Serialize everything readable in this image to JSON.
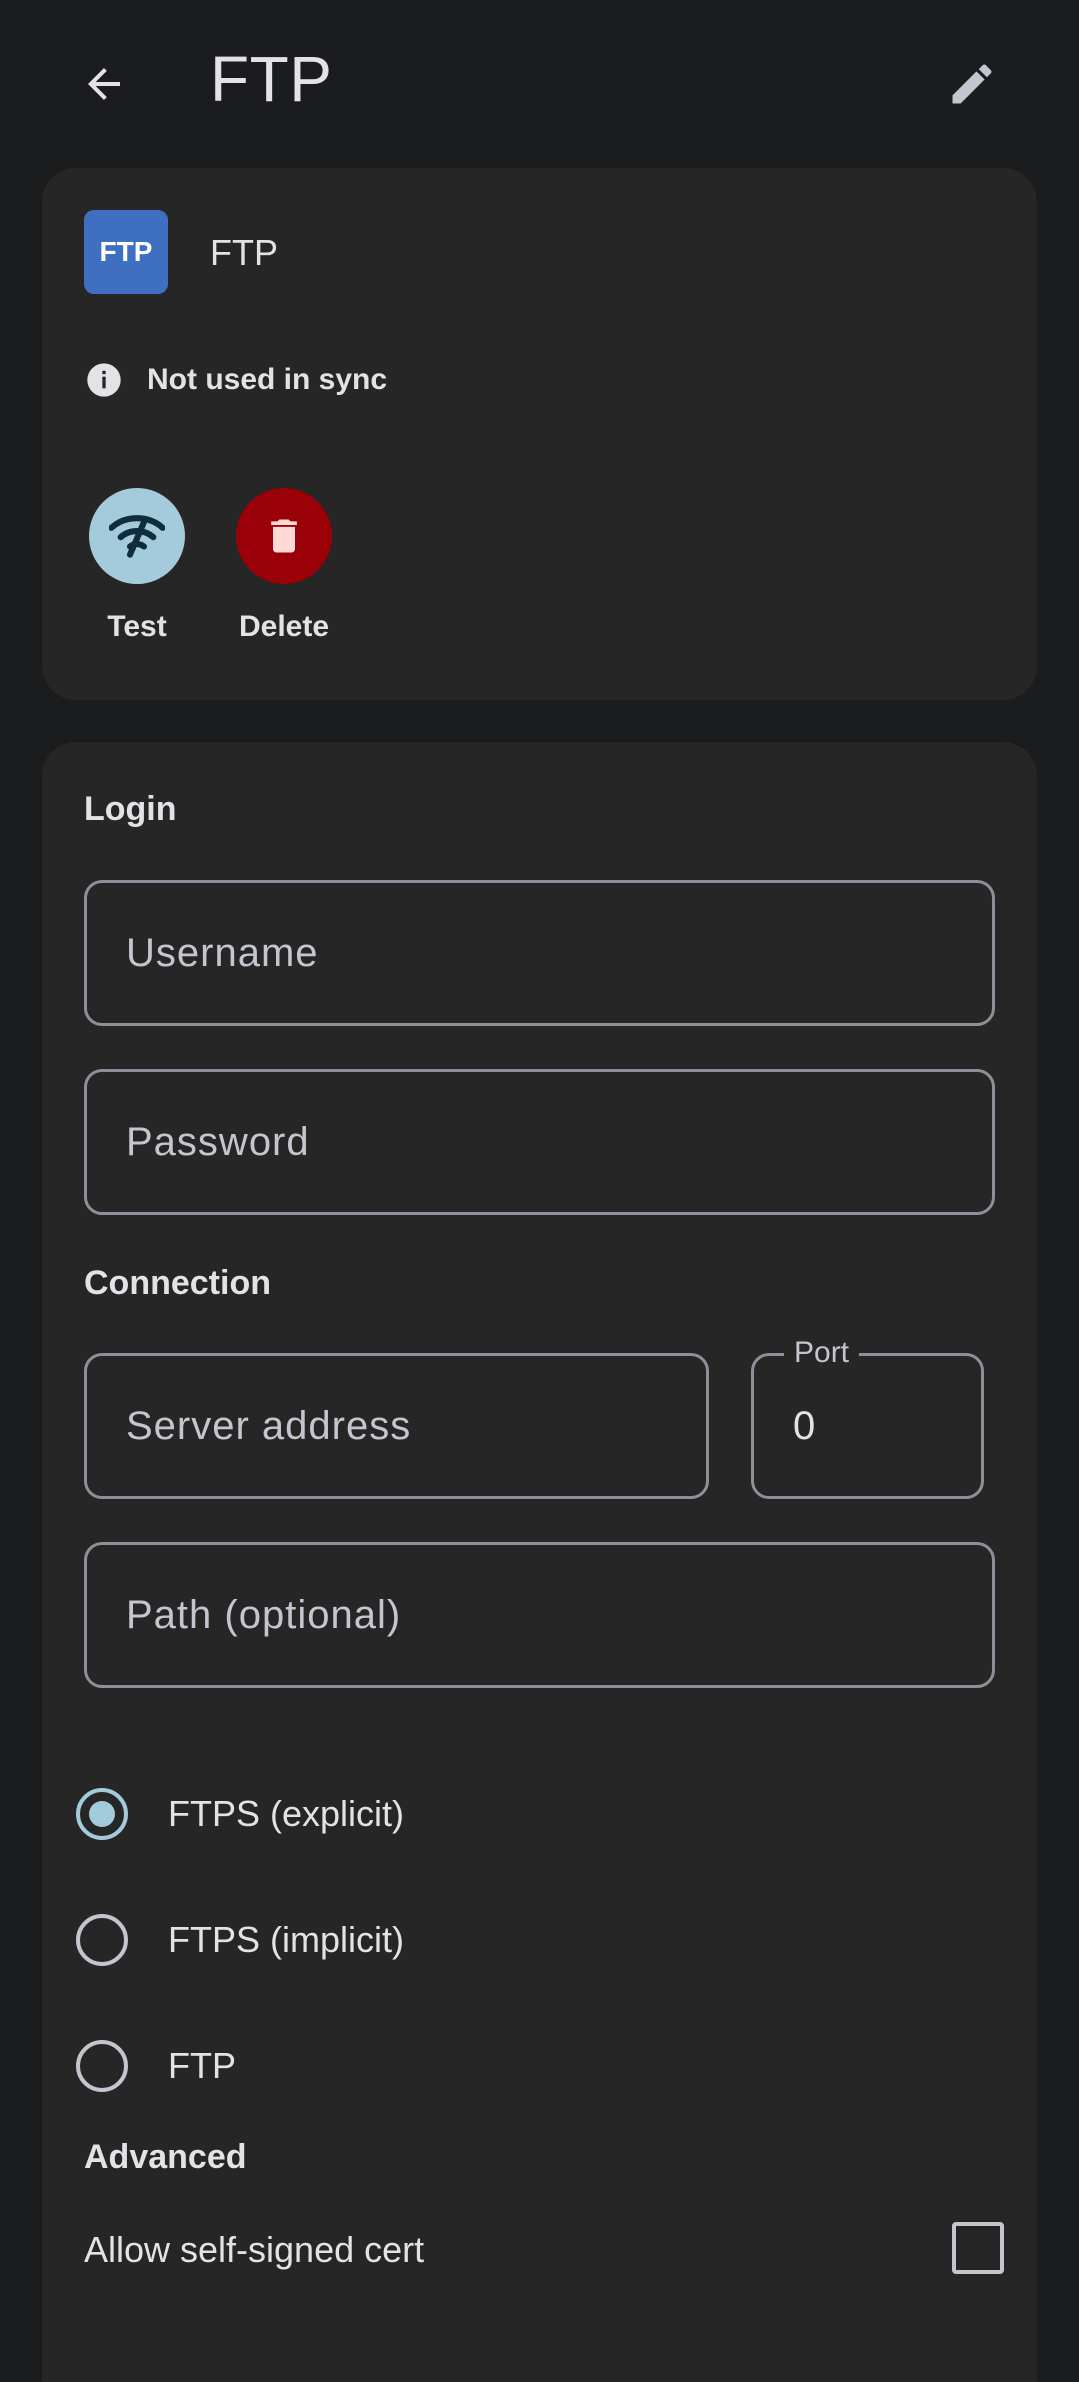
{
  "header": {
    "title": "FTP"
  },
  "account": {
    "badge_text": "FTP",
    "name": "FTP",
    "sync_status": "Not used in sync",
    "actions": [
      {
        "label": "Test",
        "icon": "wifi-off-icon"
      },
      {
        "label": "Delete",
        "icon": "trash-icon"
      }
    ]
  },
  "login": {
    "section_title": "Login",
    "username_placeholder": "Username",
    "password_placeholder": "Password"
  },
  "connection": {
    "section_title": "Connection",
    "server_placeholder": "Server address",
    "port_label": "Port",
    "port_value": "0",
    "path_placeholder": "Path (optional)",
    "protocols": [
      {
        "label": "FTPS (explicit)",
        "selected": true
      },
      {
        "label": "FTPS (implicit)",
        "selected": false
      },
      {
        "label": "FTP",
        "selected": false
      }
    ]
  },
  "advanced": {
    "section_title": "Advanced",
    "self_signed_label": "Allow self-signed cert",
    "self_signed_checked": false
  },
  "colors": {
    "background": "#1a1c1e",
    "card": "#262626",
    "accent": "#a4cbdc",
    "danger": "#9a0007",
    "ftp_badge": "#3f6fc0"
  }
}
